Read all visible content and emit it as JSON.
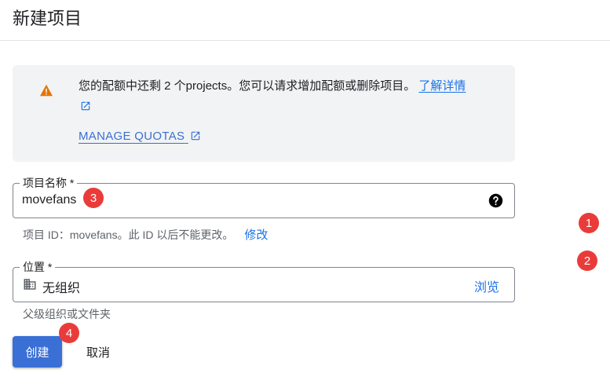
{
  "page": {
    "title": "新建项目"
  },
  "quota": {
    "message": "您的配额中还剩 2 个projects。您可以请求增加配额或删除项目。",
    "learn_more": "了解详情",
    "manage_quotas": "MANAGE QUOTAS",
    "icon": "warning-icon"
  },
  "project_name": {
    "label": "项目名称 *",
    "value": "movefans",
    "help_icon": "help-circle-icon"
  },
  "project_id": {
    "prefix": "项目 ID：",
    "id": "movefans",
    "suffix": "。此 ID 以后不能更改。",
    "modify": "修改"
  },
  "location": {
    "label": "位置 *",
    "value": "无组织",
    "browse": "浏览",
    "hint": "父级组织或文件夹",
    "icon": "organization-icon"
  },
  "actions": {
    "create": "创建",
    "cancel": "取消"
  },
  "markers": [
    "1",
    "2",
    "3",
    "4"
  ],
  "colors": {
    "accent": "#1a73e8",
    "primary_button": "#3a6fd6",
    "warning": "#e37400",
    "marker": "#ea3b3b",
    "info_box_bg": "#f1f3f4"
  }
}
